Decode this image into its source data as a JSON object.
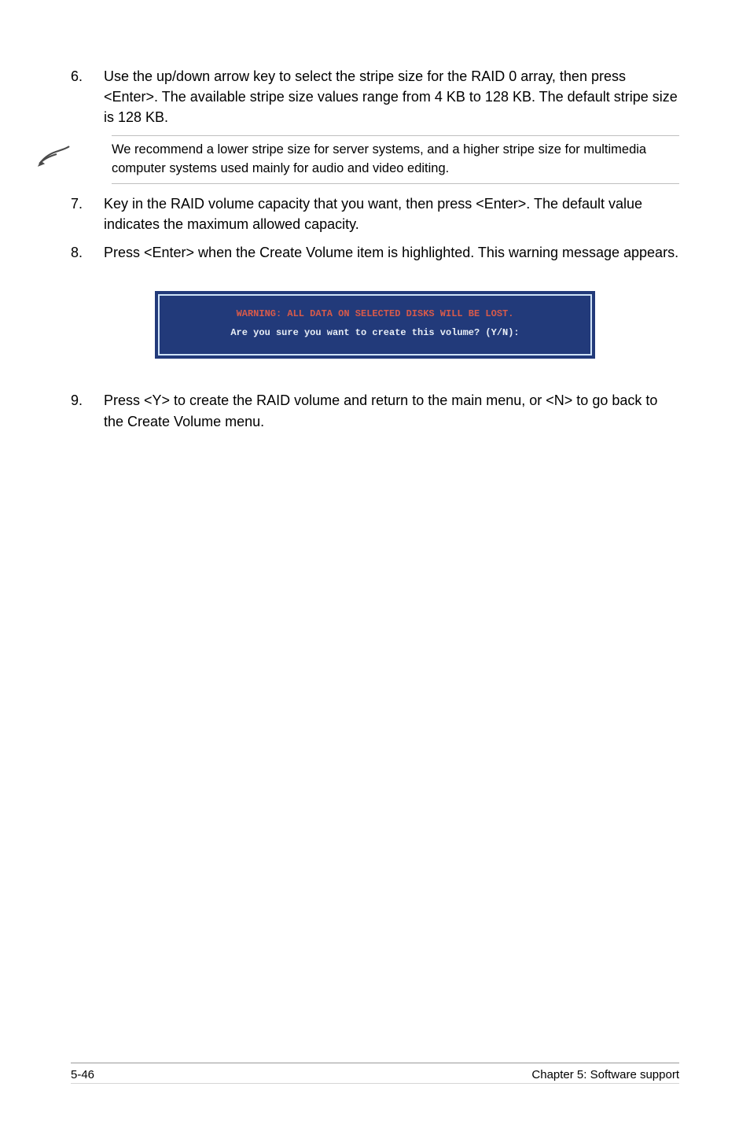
{
  "steps": [
    {
      "num": "6.",
      "text": "Use the up/down arrow key to select the stripe size for the RAID 0 array, then press <Enter>. The available stripe size values range from 4 KB to 128 KB. The default stripe size is 128 KB."
    },
    {
      "num": "7.",
      "text": "Key in the RAID volume capacity that you want, then press <Enter>. The default value indicates the maximum allowed capacity."
    },
    {
      "num": "8.",
      "text": "Press <Enter> when the Create Volume item is highlighted. This warning message appears."
    },
    {
      "num": "9.",
      "text": "Press <Y> to create the RAID volume and return to the main menu, or <N> to go back to the Create Volume menu."
    }
  ],
  "note": {
    "icon_name": "pencil-note-icon",
    "text": "We recommend a lower stripe size for server systems, and a higher stripe size for multimedia computer systems used mainly for audio and video editing."
  },
  "terminal": {
    "warning": "WARNING: ALL DATA ON SELECTED DISKS WILL BE LOST.",
    "prompt": "Are you sure you want to create this volume? (Y/N):"
  },
  "footer": {
    "left": "5-46",
    "right": "Chapter 5: Software support"
  }
}
